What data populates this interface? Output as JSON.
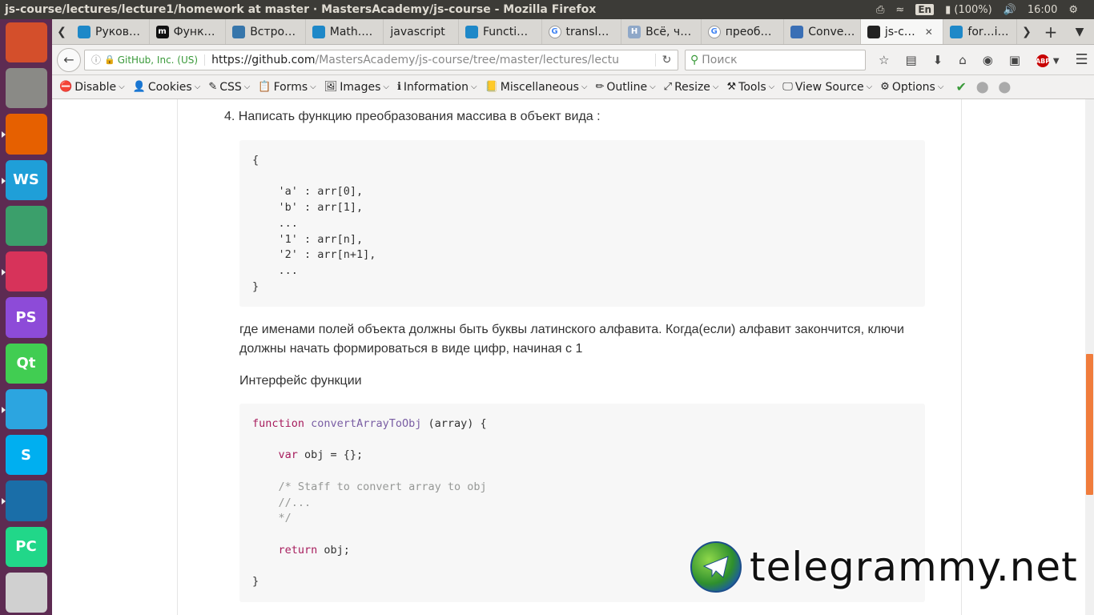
{
  "os": {
    "window_title": "js-course/lectures/lecture1/homework at master · MastersAcademy/js-course - Mozilla Firefox",
    "keyboard": "En",
    "battery": "(100%)",
    "clock": "16:00"
  },
  "launcher": {
    "items": [
      {
        "name": "ubuntu-dash",
        "label": "",
        "color": "#d44f2b"
      },
      {
        "name": "files",
        "label": "",
        "color": "#8a8a86"
      },
      {
        "name": "firefox",
        "label": "",
        "color": "#e66000"
      },
      {
        "name": "webstorm",
        "label": "WS",
        "color": "#1f9fd8"
      },
      {
        "name": "atom",
        "label": "",
        "color": "#3b9f6b"
      },
      {
        "name": "gitkraken",
        "label": "",
        "color": "#d7335a"
      },
      {
        "name": "phpstorm",
        "label": "PS",
        "color": "#8d4bd8"
      },
      {
        "name": "qt-creator",
        "label": "Qt",
        "color": "#41cd52"
      },
      {
        "name": "telegram",
        "label": "",
        "color": "#2ca5e0"
      },
      {
        "name": "skype",
        "label": "S",
        "color": "#00aff0"
      },
      {
        "name": "app",
        "label": "",
        "color": "#1a6ea8"
      },
      {
        "name": "pycharm",
        "label": "PC",
        "color": "#21d789"
      },
      {
        "name": "drive",
        "label": "",
        "color": "#d0d0d0"
      }
    ]
  },
  "tabs": [
    {
      "label": "Руков…",
      "fav": "",
      "color": "#1e88c8"
    },
    {
      "label": "Функ…",
      "fav": "m",
      "color": "#111111"
    },
    {
      "label": "Встро…",
      "fav": "",
      "color": "#3776ab"
    },
    {
      "label": "Math.…",
      "fav": "",
      "color": "#1e88c8"
    },
    {
      "label": "javascript",
      "fav": "",
      "color": ""
    },
    {
      "label": "Functi…",
      "fav": "",
      "color": "#1e88c8"
    },
    {
      "label": "transl…",
      "fav": "G",
      "color": "#ffffff"
    },
    {
      "label": "Всё, ч…",
      "fav": "H",
      "color": "#8fa8c8"
    },
    {
      "label": "преоб…",
      "fav": "G",
      "color": "#ffffff"
    },
    {
      "label": "Conve…",
      "fav": "",
      "color": "#3a6fb5"
    },
    {
      "label": "js-c…",
      "fav": "",
      "color": "#222222",
      "active": true
    },
    {
      "label": "for…i…",
      "fav": "",
      "color": "#1e88c8"
    }
  ],
  "nav": {
    "site_identity": "GitHub, Inc. (US)",
    "url_host": "https://github.com",
    "url_path": "/MastersAcademy/js-course/tree/master/lectures/lectu",
    "search_placeholder": "Поиск"
  },
  "devbar": {
    "items": [
      "Disable",
      "Cookies",
      "CSS",
      "Forms",
      "Images",
      "Information",
      "Miscellaneous",
      "Outline",
      "Resize",
      "Tools",
      "View Source",
      "Options"
    ]
  },
  "content": {
    "task_number": "4.",
    "task_text": "Написать функцию преобразования массива в объект вида :",
    "code1": "{\n\n    'a' : arr[0],\n    'b' : arr[1],\n    ...\n    '1' : arr[n],\n    '2' : arr[n+1],\n    ...\n}",
    "para_line1": "где именами полей объекта должны быть буквы латинского алфавита. Когда(если) алфавит закончится, ключи",
    "para_line2": "должны начать формироваться в виде цифр, начиная с 1",
    "interface_heading": "Интерфейс функции",
    "code2": {
      "kw_function": "function",
      "fn_name": "convertArrayToObj",
      "signature_rest": " (array) {",
      "kw_var": "var",
      "var_rest": " obj = {};",
      "comment": "/* Staff to convert array to obj\n    //...\n    */",
      "kw_return": "return",
      "return_rest": " obj;",
      "close": "}"
    }
  },
  "watermark": "telegrammy.net"
}
